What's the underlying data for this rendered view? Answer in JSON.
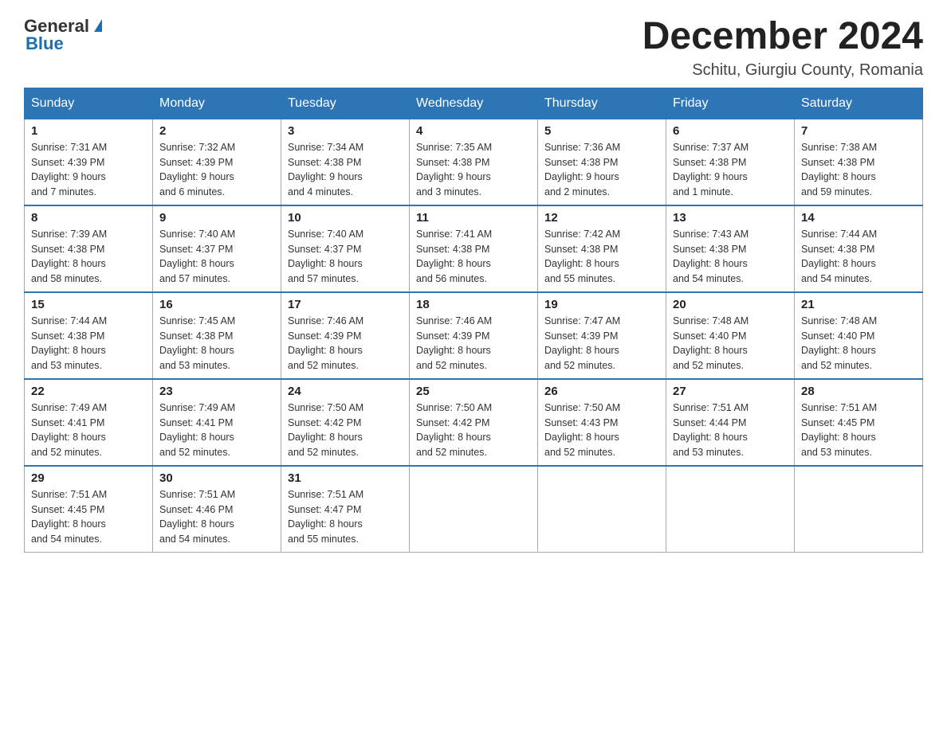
{
  "header": {
    "logo_general": "General",
    "logo_blue": "Blue",
    "month_title": "December 2024",
    "location": "Schitu, Giurgiu County, Romania"
  },
  "weekdays": [
    "Sunday",
    "Monday",
    "Tuesday",
    "Wednesday",
    "Thursday",
    "Friday",
    "Saturday"
  ],
  "weeks": [
    [
      {
        "day": "1",
        "sunrise": "7:31 AM",
        "sunset": "4:39 PM",
        "daylight": "9 hours and 7 minutes."
      },
      {
        "day": "2",
        "sunrise": "7:32 AM",
        "sunset": "4:39 PM",
        "daylight": "9 hours and 6 minutes."
      },
      {
        "day": "3",
        "sunrise": "7:34 AM",
        "sunset": "4:38 PM",
        "daylight": "9 hours and 4 minutes."
      },
      {
        "day": "4",
        "sunrise": "7:35 AM",
        "sunset": "4:38 PM",
        "daylight": "9 hours and 3 minutes."
      },
      {
        "day": "5",
        "sunrise": "7:36 AM",
        "sunset": "4:38 PM",
        "daylight": "9 hours and 2 minutes."
      },
      {
        "day": "6",
        "sunrise": "7:37 AM",
        "sunset": "4:38 PM",
        "daylight": "9 hours and 1 minute."
      },
      {
        "day": "7",
        "sunrise": "7:38 AM",
        "sunset": "4:38 PM",
        "daylight": "8 hours and 59 minutes."
      }
    ],
    [
      {
        "day": "8",
        "sunrise": "7:39 AM",
        "sunset": "4:38 PM",
        "daylight": "8 hours and 58 minutes."
      },
      {
        "day": "9",
        "sunrise": "7:40 AM",
        "sunset": "4:37 PM",
        "daylight": "8 hours and 57 minutes."
      },
      {
        "day": "10",
        "sunrise": "7:40 AM",
        "sunset": "4:37 PM",
        "daylight": "8 hours and 57 minutes."
      },
      {
        "day": "11",
        "sunrise": "7:41 AM",
        "sunset": "4:38 PM",
        "daylight": "8 hours and 56 minutes."
      },
      {
        "day": "12",
        "sunrise": "7:42 AM",
        "sunset": "4:38 PM",
        "daylight": "8 hours and 55 minutes."
      },
      {
        "day": "13",
        "sunrise": "7:43 AM",
        "sunset": "4:38 PM",
        "daylight": "8 hours and 54 minutes."
      },
      {
        "day": "14",
        "sunrise": "7:44 AM",
        "sunset": "4:38 PM",
        "daylight": "8 hours and 54 minutes."
      }
    ],
    [
      {
        "day": "15",
        "sunrise": "7:44 AM",
        "sunset": "4:38 PM",
        "daylight": "8 hours and 53 minutes."
      },
      {
        "day": "16",
        "sunrise": "7:45 AM",
        "sunset": "4:38 PM",
        "daylight": "8 hours and 53 minutes."
      },
      {
        "day": "17",
        "sunrise": "7:46 AM",
        "sunset": "4:39 PM",
        "daylight": "8 hours and 52 minutes."
      },
      {
        "day": "18",
        "sunrise": "7:46 AM",
        "sunset": "4:39 PM",
        "daylight": "8 hours and 52 minutes."
      },
      {
        "day": "19",
        "sunrise": "7:47 AM",
        "sunset": "4:39 PM",
        "daylight": "8 hours and 52 minutes."
      },
      {
        "day": "20",
        "sunrise": "7:48 AM",
        "sunset": "4:40 PM",
        "daylight": "8 hours and 52 minutes."
      },
      {
        "day": "21",
        "sunrise": "7:48 AM",
        "sunset": "4:40 PM",
        "daylight": "8 hours and 52 minutes."
      }
    ],
    [
      {
        "day": "22",
        "sunrise": "7:49 AM",
        "sunset": "4:41 PM",
        "daylight": "8 hours and 52 minutes."
      },
      {
        "day": "23",
        "sunrise": "7:49 AM",
        "sunset": "4:41 PM",
        "daylight": "8 hours and 52 minutes."
      },
      {
        "day": "24",
        "sunrise": "7:50 AM",
        "sunset": "4:42 PM",
        "daylight": "8 hours and 52 minutes."
      },
      {
        "day": "25",
        "sunrise": "7:50 AM",
        "sunset": "4:42 PM",
        "daylight": "8 hours and 52 minutes."
      },
      {
        "day": "26",
        "sunrise": "7:50 AM",
        "sunset": "4:43 PM",
        "daylight": "8 hours and 52 minutes."
      },
      {
        "day": "27",
        "sunrise": "7:51 AM",
        "sunset": "4:44 PM",
        "daylight": "8 hours and 53 minutes."
      },
      {
        "day": "28",
        "sunrise": "7:51 AM",
        "sunset": "4:45 PM",
        "daylight": "8 hours and 53 minutes."
      }
    ],
    [
      {
        "day": "29",
        "sunrise": "7:51 AM",
        "sunset": "4:45 PM",
        "daylight": "8 hours and 54 minutes."
      },
      {
        "day": "30",
        "sunrise": "7:51 AM",
        "sunset": "4:46 PM",
        "daylight": "8 hours and 54 minutes."
      },
      {
        "day": "31",
        "sunrise": "7:51 AM",
        "sunset": "4:47 PM",
        "daylight": "8 hours and 55 minutes."
      },
      null,
      null,
      null,
      null
    ]
  ],
  "labels": {
    "sunrise": "Sunrise: ",
    "sunset": "Sunset: ",
    "daylight": "Daylight: "
  }
}
